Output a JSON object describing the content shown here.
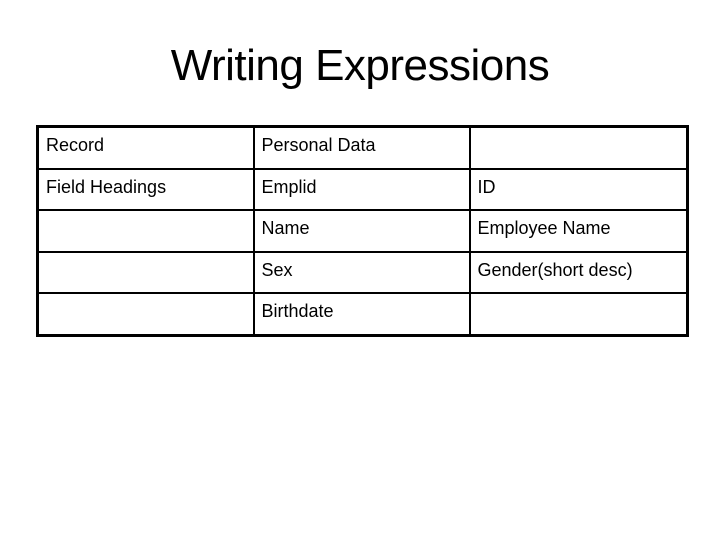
{
  "slide": {
    "title": "Writing Expressions"
  },
  "table": {
    "rows": [
      [
        "Record",
        "Personal Data",
        ""
      ],
      [
        "Field Headings",
        "Emplid",
        "ID"
      ],
      [
        "",
        "Name",
        "Employee Name"
      ],
      [
        "",
        "Sex",
        "Gender(short desc)"
      ],
      [
        "",
        "Birthdate",
        ""
      ]
    ]
  }
}
